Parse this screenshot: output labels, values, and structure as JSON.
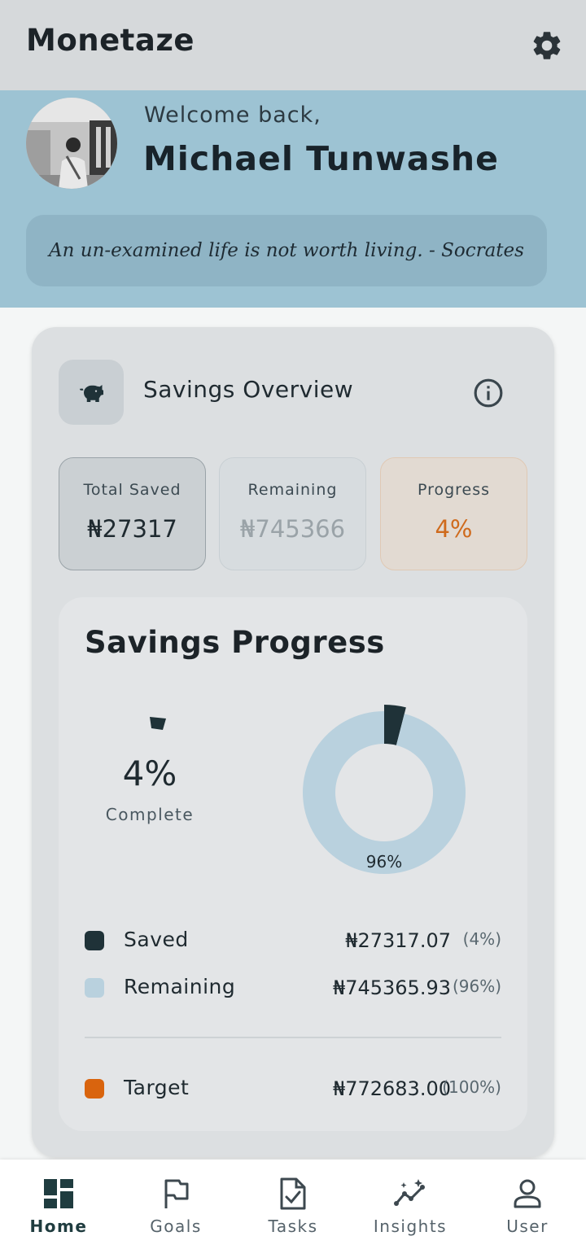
{
  "app": {
    "title": "Monetaze"
  },
  "welcome": {
    "greeting": "Welcome back,",
    "name": "Michael Tunwashe",
    "quote": "An un-examined life is not worth living. - Socrates"
  },
  "overview": {
    "title": "Savings Overview",
    "stats": [
      {
        "label": "Total Saved",
        "value": "₦27317"
      },
      {
        "label": "Remaining",
        "value": "₦745366"
      },
      {
        "label": "Progress",
        "value": "4%"
      }
    ]
  },
  "progress_card": {
    "title": "Savings Progress",
    "percent_text": "4%",
    "complete_label": "Complete",
    "donut_label": "96%",
    "legend": [
      {
        "label": "Saved",
        "amount": "₦27317.07",
        "pct": "(4%)",
        "color": "#1f3238"
      },
      {
        "label": "Remaining",
        "amount": "₦745365.93",
        "pct": "(96%)",
        "color": "#b9d1de"
      },
      {
        "label": "Target",
        "amount": "₦772683.00",
        "pct": "(100%)",
        "color": "#d9640e"
      }
    ]
  },
  "chart_data": {
    "type": "pie",
    "categories": [
      "Saved",
      "Remaining"
    ],
    "values": [
      4,
      96
    ],
    "colors": [
      "#1f3238",
      "#b9d1de"
    ]
  },
  "nav": {
    "items": [
      {
        "label": "Home",
        "icon": "dashboard-icon"
      },
      {
        "label": "Goals",
        "icon": "flag-icon"
      },
      {
        "label": "Tasks",
        "icon": "task-check-icon"
      },
      {
        "label": "Insights",
        "icon": "insights-icon"
      },
      {
        "label": "User",
        "icon": "user-icon"
      }
    ],
    "active": "Home"
  },
  "colors": {
    "appbar": "#d6d9db",
    "welcome_bg": "#9dc3d3",
    "accent_dark": "#1f3238",
    "accent_orange": "#d9640e"
  }
}
